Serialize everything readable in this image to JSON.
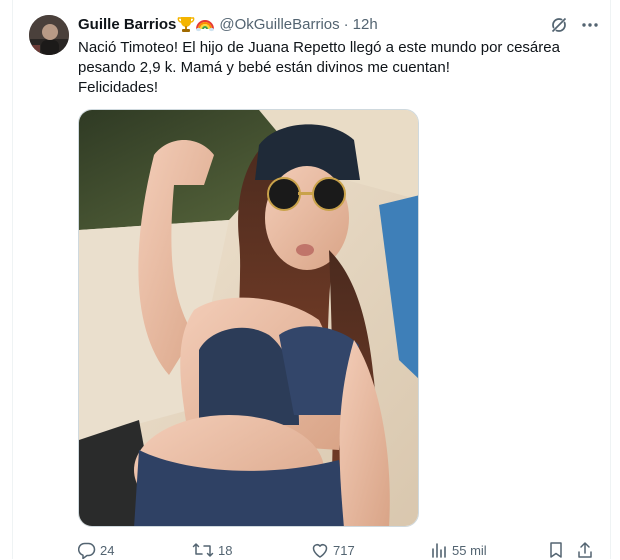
{
  "tweet": {
    "author": {
      "display_name": "Guille Barrios",
      "badges": [
        "trophy-emoji",
        "rainbow-emoji"
      ],
      "handle": "@OkGuilleBarrios",
      "separator": "·",
      "time": "12h"
    },
    "text_lines": [
      "Nació Timoteo! El hijo de Juana Repetto llegó a este mundo por cesárea",
      "pesando 2,9 k. Mamá y bebé están divinos me cuentan!",
      "Felicidades!"
    ],
    "media": {
      "type": "photo",
      "icon": "photo"
    },
    "actions": {
      "replies": "24",
      "reposts": "18",
      "likes": "717",
      "views": "55 mil"
    }
  },
  "icons": {
    "grok": "grok-icon",
    "more": "more-icon",
    "reply": "reply-icon",
    "repost": "repost-icon",
    "like": "heart-icon",
    "views": "views-icon",
    "bookmark": "bookmark-icon",
    "share": "share-icon"
  },
  "colors": {
    "text": "#0f1419",
    "muted": "#536471",
    "border": "#cfd9de"
  }
}
